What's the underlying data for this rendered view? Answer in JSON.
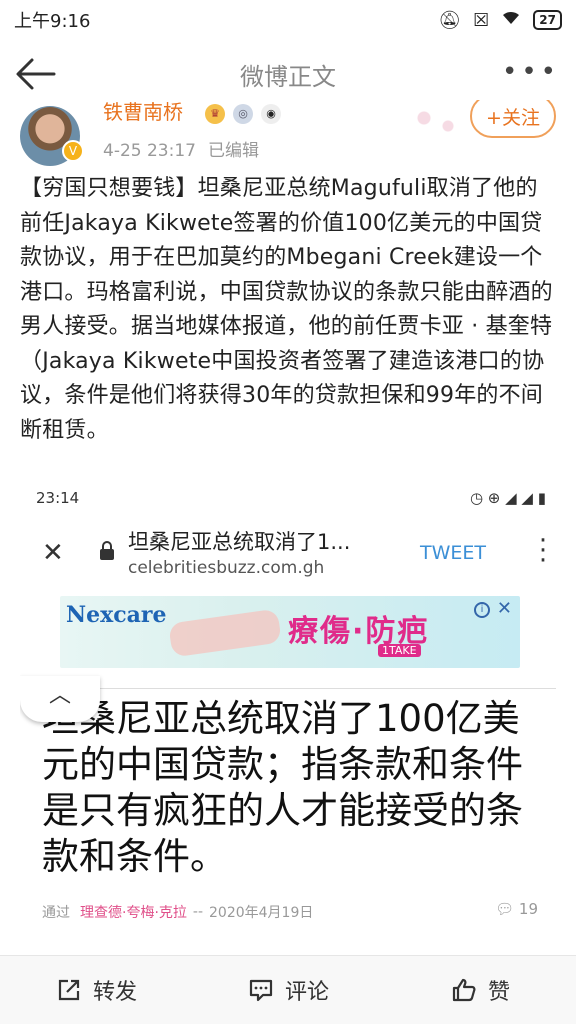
{
  "status_bar": {
    "time": "上午9:16",
    "battery": "27"
  },
  "nav": {
    "title": "微博正文"
  },
  "author": {
    "name": "铁曹南桥",
    "date": "4-25 23:17",
    "edited": "已编辑",
    "follow_label": "+关注"
  },
  "post": {
    "text": "【穷国只想要钱】坦桑尼亚总统Magufuli取消了他的前任Jakaya Kikwete签署的价值100亿美元的中国贷款协议，用于在巴加莫约的Mbegani Creek建设一个港口。玛格富利说，中国贷款协议的条款只能由醉酒的男人接受。据当地媒体报道，他的前任贾卡亚 · 基奎特（Jakaya Kikwete中国投资者签署了建造该港口的协议，条件是他们将获得30年的贷款担保和99年的不间断租赁。"
  },
  "screenshot": {
    "time": "23:14",
    "page_title": "坦桑尼亚总统取消了1...",
    "url": "celebritiesbuzz.com.gh",
    "tweet_label": "TWEET",
    "ad_brand": "Nexcare",
    "ad_slogan": "療傷·防疤",
    "ad_tag": "1TAKE",
    "headline": "坦桑尼亚总统取消了100亿美元的中国贷款；指条款和条件是只有疯狂的人才能接受的条款和条件。",
    "byline_prefix": "通过",
    "byline_author": "理查德·夸梅·克拉",
    "byline_sep": "--",
    "byline_date": "2020年4月19日",
    "comment_count": "19"
  },
  "actions": {
    "repost": "转发",
    "comment": "评论",
    "like": "赞"
  }
}
